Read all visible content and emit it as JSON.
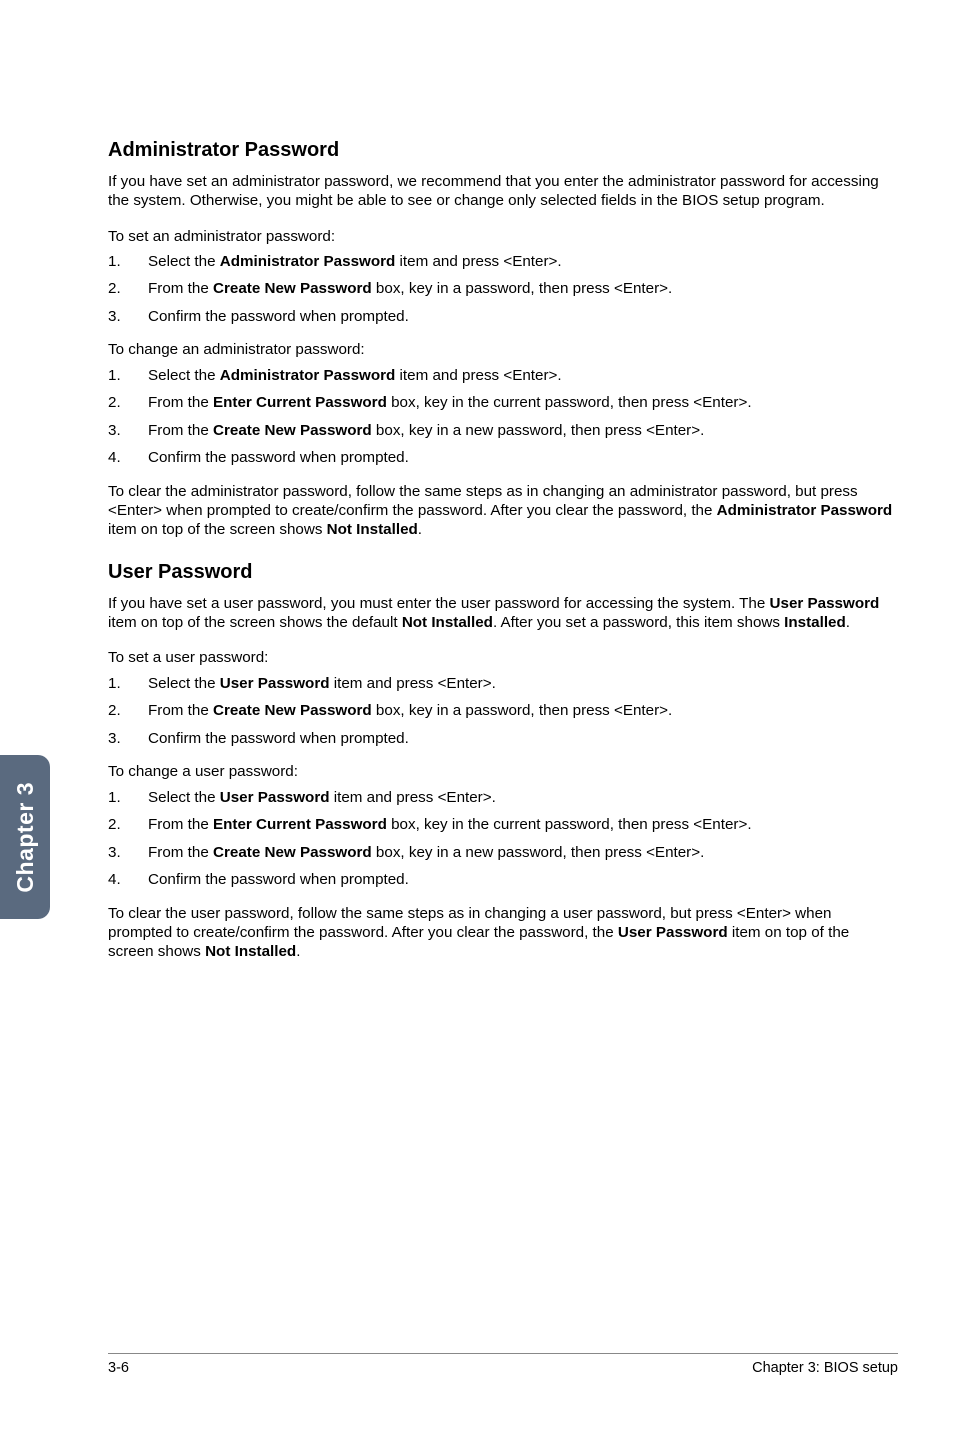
{
  "sidebar": {
    "label": "Chapter 3"
  },
  "footer": {
    "page": "3-6",
    "chapter": "Chapter 3: BIOS setup"
  },
  "admin": {
    "heading": "Administrator Password",
    "intro": "If you have set an administrator password, we recommend that you enter the administrator password for accessing the system. Otherwise, you might be able to see or change only selected fields in the BIOS setup program.",
    "set_lead": "To set an administrator password:",
    "set_steps": {
      "s1a": "Select the ",
      "s1b": "Administrator Password",
      "s1c": " item and press <Enter>.",
      "s2a": "From the ",
      "s2b": "Create New Password",
      "s2c": " box, key in a password, then press <Enter>.",
      "s3": "Confirm the password when prompted."
    },
    "change_lead": "To change an administrator password:",
    "change_steps": {
      "s1a": "Select the ",
      "s1b": "Administrator Password",
      "s1c": " item and press <Enter>.",
      "s2a": "From the ",
      "s2b": "Enter Current Password",
      "s2c": " box, key in the current password, then press <Enter>.",
      "s3a": "From the ",
      "s3b": "Create New Password",
      "s3c": " box, key in a new password, then press <Enter>.",
      "s4": "Confirm the password when prompted."
    },
    "clear_a": "To clear the administrator password, follow the same steps as in changing an administrator password, but press <Enter> when prompted to create/confirm the password. After you clear the password, the ",
    "clear_b": "Administrator Password",
    "clear_c": " item on top of the screen shows ",
    "clear_d": "Not Installed",
    "clear_e": "."
  },
  "user": {
    "heading": "User Password",
    "intro_a": "If you have set a user password, you must enter the user password for accessing the system. The ",
    "intro_b": "User Password",
    "intro_c": " item on top of the screen shows the default ",
    "intro_d": "Not Installed",
    "intro_e": ". After you set a password, this item shows ",
    "intro_f": "Installed",
    "intro_g": ".",
    "set_lead": "To set a user password:",
    "set_steps": {
      "s1a": "Select the ",
      "s1b": "User Password",
      "s1c": " item and press <Enter>.",
      "s2a": "From the ",
      "s2b": "Create New Password",
      "s2c": " box, key in a password, then press <Enter>.",
      "s3": "Confirm the password when prompted."
    },
    "change_lead": "To change a user password:",
    "change_steps": {
      "s1a": "Select the ",
      "s1b": "User Password",
      "s1c": " item and press <Enter>.",
      "s2a": "From the ",
      "s2b": "Enter Current Password",
      "s2c": " box, key in the current password, then press <Enter>.",
      "s3a": "From the ",
      "s3b": "Create New Password",
      "s3c": " box, key in a new password, then press <Enter>.",
      "s4": "Confirm the password when prompted."
    },
    "clear_a": "To clear the user password, follow the same steps as in changing a user password, but press <Enter> when prompted to create/confirm the password. After you clear the password, the ",
    "clear_b": "User Password",
    "clear_c": " item on top of the screen shows ",
    "clear_d": "Not Installed",
    "clear_e": "."
  },
  "nums": {
    "n1": "1.",
    "n2": "2.",
    "n3": "3.",
    "n4": "4."
  }
}
